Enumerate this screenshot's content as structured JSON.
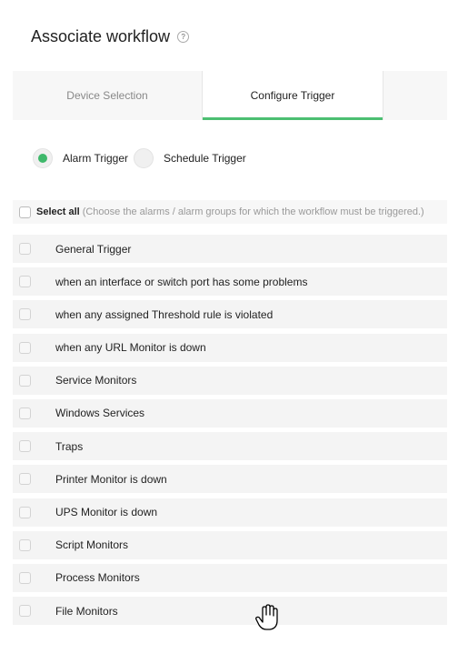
{
  "header": {
    "title": "Associate workflow",
    "help_glyph": "?"
  },
  "tabs": [
    {
      "label": "Device Selection",
      "active": false
    },
    {
      "label": "Configure Trigger",
      "active": true
    }
  ],
  "trigger_type": {
    "options": [
      {
        "label": "Alarm Trigger",
        "selected": true
      },
      {
        "label": "Schedule Trigger",
        "selected": false
      }
    ]
  },
  "select_all": {
    "label": "Select all",
    "hint": "(Choose the alarms / alarm groups for which the workflow must be triggered.)",
    "checked": false
  },
  "alarms": [
    {
      "label": "General Trigger",
      "checked": false
    },
    {
      "label": "when an interface or switch port has some problems",
      "checked": false
    },
    {
      "label": "when any assigned Threshold rule is violated",
      "checked": false
    },
    {
      "label": "when any URL Monitor is down",
      "checked": false
    },
    {
      "label": "Service Monitors",
      "checked": false
    },
    {
      "label": "Windows Services",
      "checked": false
    },
    {
      "label": "Traps",
      "checked": false
    },
    {
      "label": "Printer Monitor is down",
      "checked": false
    },
    {
      "label": "UPS Monitor is down",
      "checked": false
    },
    {
      "label": "Script Monitors",
      "checked": false
    },
    {
      "label": "Process Monitors",
      "checked": false
    },
    {
      "label": "File Monitors",
      "checked": false
    }
  ],
  "colors": {
    "accent": "#4cbf72",
    "radio_selected": "#3fb86b",
    "row_bg": "#f4f4f4"
  },
  "cursor": {
    "icon": "hand-pointer-icon"
  }
}
